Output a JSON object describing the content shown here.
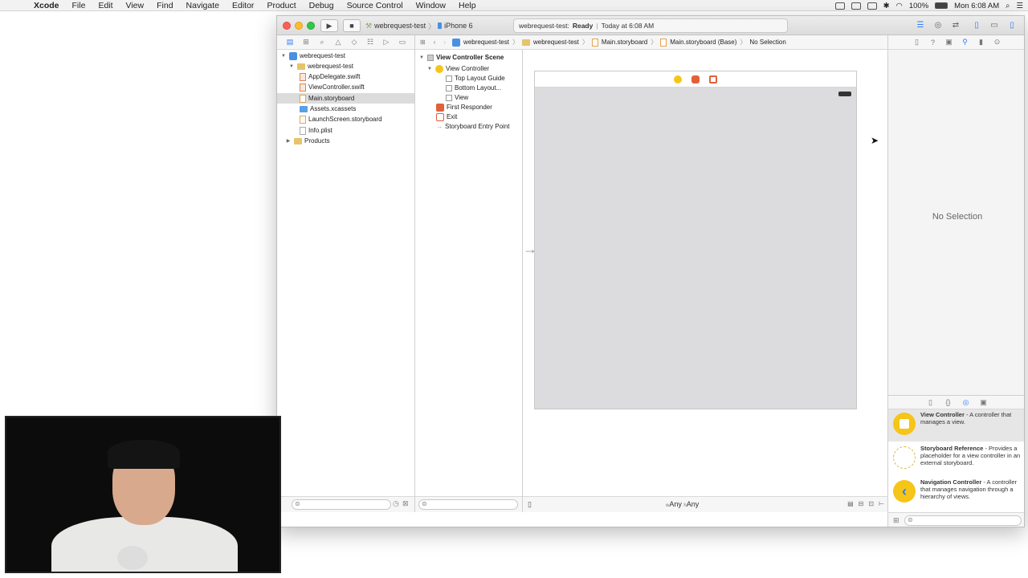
{
  "menubar": {
    "app": "Xcode",
    "items": [
      "File",
      "Edit",
      "View",
      "Find",
      "Navigate",
      "Editor",
      "Product",
      "Debug",
      "Source Control",
      "Window",
      "Help"
    ],
    "battery": "100%",
    "clock": "Mon 6:08 AM"
  },
  "toolbar": {
    "scheme": "webrequest-test",
    "destination": "iPhone 6",
    "activity_project": "webrequest-test:",
    "activity_status": "Ready",
    "activity_time": "Today at 6:08 AM"
  },
  "navigator": {
    "items": [
      {
        "label": "webrequest-test"
      },
      {
        "label": "webrequest-test"
      },
      {
        "label": "AppDelegate.swift"
      },
      {
        "label": "ViewController.swift"
      },
      {
        "label": "Main.storyboard"
      },
      {
        "label": "Assets.xcassets"
      },
      {
        "label": "LaunchScreen.storyboard"
      },
      {
        "label": "Info.plist"
      },
      {
        "label": "Products"
      }
    ]
  },
  "jumpbar": {
    "crumbs": [
      "webrequest-test",
      "webrequest-test",
      "Main.storyboard",
      "Main.storyboard (Base)",
      "No Selection"
    ]
  },
  "outline": {
    "items": [
      {
        "label": "View Controller Scene"
      },
      {
        "label": "View Controller"
      },
      {
        "label": "Top Layout Guide"
      },
      {
        "label": "Bottom Layout..."
      },
      {
        "label": "View"
      },
      {
        "label": "First Responder"
      },
      {
        "label": "Exit"
      },
      {
        "label": "Storyboard Entry Point"
      }
    ]
  },
  "canvas": {
    "size_w_prefix": "w",
    "size_w": "Any",
    "size_h_prefix": "h",
    "size_h": "Any"
  },
  "inspector": {
    "empty_text": "No Selection"
  },
  "library": {
    "items": [
      {
        "title": "View Controller",
        "desc": " - A controller that manages a view."
      },
      {
        "title": "Storyboard Reference",
        "desc": " - Provides a placeholder for a view controller in an external storyboard."
      },
      {
        "title": "Navigation Controller",
        "desc": " - A controller that manages navigation through a hierarchy of views."
      }
    ]
  },
  "icons": {
    "nav_arrow": "chevron-left-icon",
    "entry": "arrow-right-icon"
  }
}
